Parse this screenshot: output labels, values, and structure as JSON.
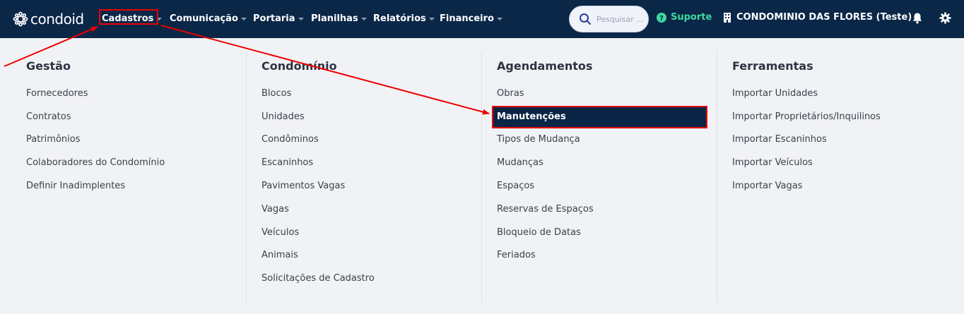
{
  "brand": {
    "name": "condoid"
  },
  "nav": {
    "items": [
      {
        "label": "Cadastros"
      },
      {
        "label": "Comunicação"
      },
      {
        "label": "Portaria"
      },
      {
        "label": "Planilhas"
      },
      {
        "label": "Relatórios"
      },
      {
        "label": "Financeiro"
      }
    ]
  },
  "search": {
    "placeholder": "Pesquisar ..."
  },
  "support": {
    "label": "Suporte"
  },
  "condominium": {
    "label": "CONDOMINIO DAS FLORES (Teste)"
  },
  "menu": {
    "columns": [
      {
        "title": "Gestão",
        "links": [
          "Fornecedores",
          "Contratos",
          "Patrimônios",
          "Colaboradores do Condomínio",
          "Definir Inadimplentes"
        ]
      },
      {
        "title": "Condomínio",
        "links": [
          "Blocos",
          "Unidades",
          "Condôminos",
          "Escaninhos",
          "Pavimentos Vagas",
          "Vagas",
          "Veículos",
          "Animais",
          "Solicitações de Cadastro"
        ]
      },
      {
        "title": "Agendamentos",
        "links": [
          "Obras",
          "Manutenções",
          "Tipos de Mudança",
          "Mudanças",
          "Espaços",
          "Reservas de Espaços",
          "Bloqueio de Datas",
          "Feriados"
        ]
      },
      {
        "title": "Ferramentas",
        "links": [
          "Importar Unidades",
          "Importar Proprietários/Inquilinos",
          "Importar Escaninhos",
          "Importar Veículos",
          "Importar Vagas"
        ]
      }
    ]
  },
  "colors": {
    "topbar": "#0a2748",
    "support": "#3ed9a0",
    "annotation": "#e00000",
    "highlight": "#0b2546"
  }
}
